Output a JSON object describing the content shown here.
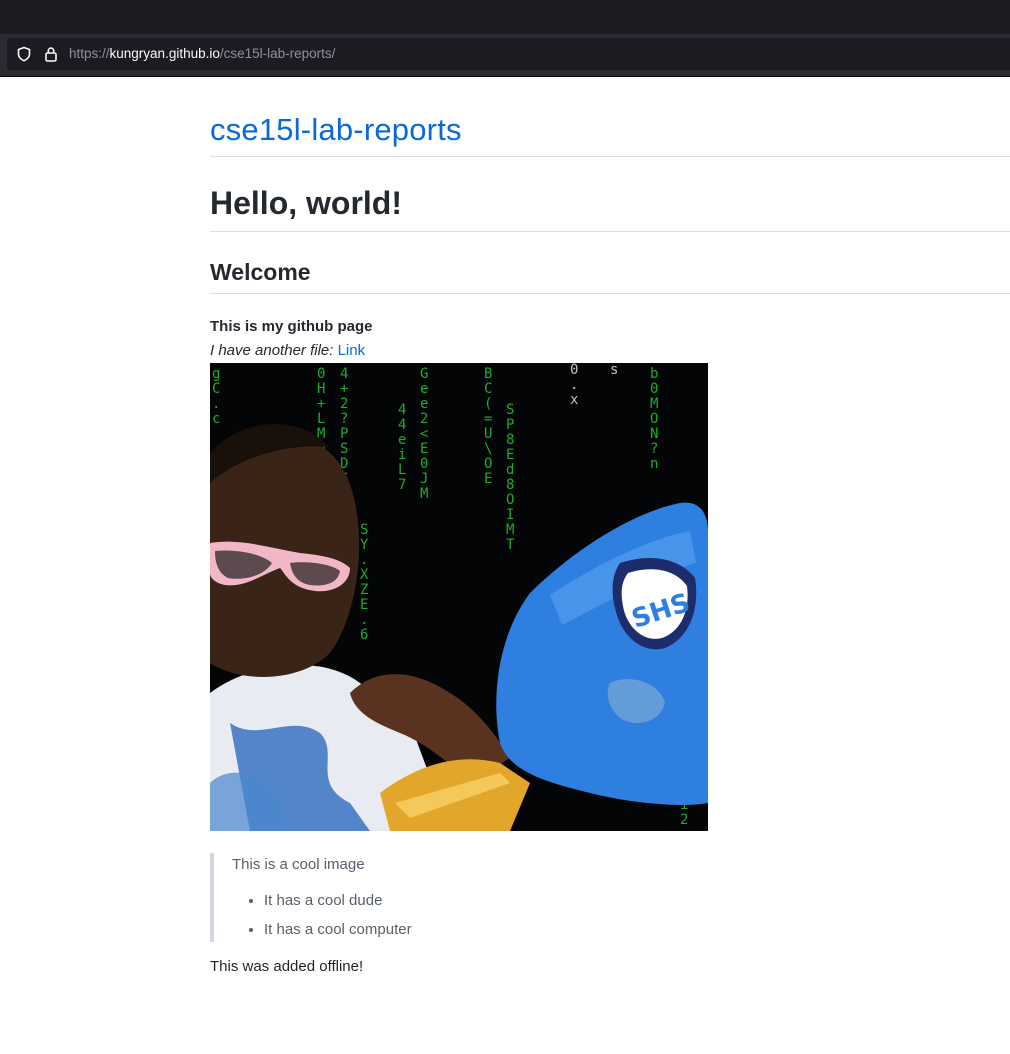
{
  "browser": {
    "url_prefix": "https://",
    "url_host": "kungryan.github.io",
    "url_path": "/cse15l-lab-reports/"
  },
  "site": {
    "title": "cse15l-lab-reports"
  },
  "page": {
    "heading": "Hello, world!",
    "section_heading": "Welcome",
    "bold_line": "This is my github page",
    "italic_prefix": "I have another file: ",
    "link_text": "Link",
    "image_alt": "meme-image",
    "image_badge": "SHS"
  },
  "quote": {
    "text": "This is a cool image",
    "items": [
      "It has a cool dude",
      "It has a cool computer"
    ]
  },
  "footer": {
    "text": "This was added offline!"
  },
  "colors": {
    "link": "#0969da",
    "laptop": "#2f7fe0",
    "matrix": "#1fbf33"
  }
}
